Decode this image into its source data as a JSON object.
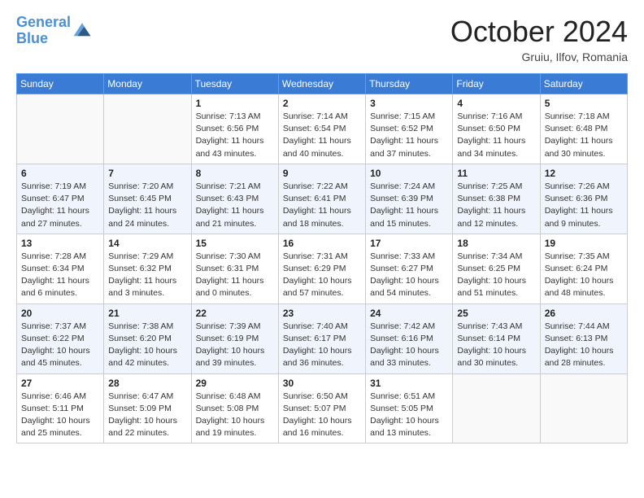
{
  "header": {
    "logo_line1": "General",
    "logo_line2": "Blue",
    "month": "October 2024",
    "location": "Gruiu, Ilfov, Romania"
  },
  "weekdays": [
    "Sunday",
    "Monday",
    "Tuesday",
    "Wednesday",
    "Thursday",
    "Friday",
    "Saturday"
  ],
  "weeks": [
    [
      {
        "day": "",
        "info": ""
      },
      {
        "day": "",
        "info": ""
      },
      {
        "day": "1",
        "info": "Sunrise: 7:13 AM\nSunset: 6:56 PM\nDaylight: 11 hours and 43 minutes."
      },
      {
        "day": "2",
        "info": "Sunrise: 7:14 AM\nSunset: 6:54 PM\nDaylight: 11 hours and 40 minutes."
      },
      {
        "day": "3",
        "info": "Sunrise: 7:15 AM\nSunset: 6:52 PM\nDaylight: 11 hours and 37 minutes."
      },
      {
        "day": "4",
        "info": "Sunrise: 7:16 AM\nSunset: 6:50 PM\nDaylight: 11 hours and 34 minutes."
      },
      {
        "day": "5",
        "info": "Sunrise: 7:18 AM\nSunset: 6:48 PM\nDaylight: 11 hours and 30 minutes."
      }
    ],
    [
      {
        "day": "6",
        "info": "Sunrise: 7:19 AM\nSunset: 6:47 PM\nDaylight: 11 hours and 27 minutes."
      },
      {
        "day": "7",
        "info": "Sunrise: 7:20 AM\nSunset: 6:45 PM\nDaylight: 11 hours and 24 minutes."
      },
      {
        "day": "8",
        "info": "Sunrise: 7:21 AM\nSunset: 6:43 PM\nDaylight: 11 hours and 21 minutes."
      },
      {
        "day": "9",
        "info": "Sunrise: 7:22 AM\nSunset: 6:41 PM\nDaylight: 11 hours and 18 minutes."
      },
      {
        "day": "10",
        "info": "Sunrise: 7:24 AM\nSunset: 6:39 PM\nDaylight: 11 hours and 15 minutes."
      },
      {
        "day": "11",
        "info": "Sunrise: 7:25 AM\nSunset: 6:38 PM\nDaylight: 11 hours and 12 minutes."
      },
      {
        "day": "12",
        "info": "Sunrise: 7:26 AM\nSunset: 6:36 PM\nDaylight: 11 hours and 9 minutes."
      }
    ],
    [
      {
        "day": "13",
        "info": "Sunrise: 7:28 AM\nSunset: 6:34 PM\nDaylight: 11 hours and 6 minutes."
      },
      {
        "day": "14",
        "info": "Sunrise: 7:29 AM\nSunset: 6:32 PM\nDaylight: 11 hours and 3 minutes."
      },
      {
        "day": "15",
        "info": "Sunrise: 7:30 AM\nSunset: 6:31 PM\nDaylight: 11 hours and 0 minutes."
      },
      {
        "day": "16",
        "info": "Sunrise: 7:31 AM\nSunset: 6:29 PM\nDaylight: 10 hours and 57 minutes."
      },
      {
        "day": "17",
        "info": "Sunrise: 7:33 AM\nSunset: 6:27 PM\nDaylight: 10 hours and 54 minutes."
      },
      {
        "day": "18",
        "info": "Sunrise: 7:34 AM\nSunset: 6:25 PM\nDaylight: 10 hours and 51 minutes."
      },
      {
        "day": "19",
        "info": "Sunrise: 7:35 AM\nSunset: 6:24 PM\nDaylight: 10 hours and 48 minutes."
      }
    ],
    [
      {
        "day": "20",
        "info": "Sunrise: 7:37 AM\nSunset: 6:22 PM\nDaylight: 10 hours and 45 minutes."
      },
      {
        "day": "21",
        "info": "Sunrise: 7:38 AM\nSunset: 6:20 PM\nDaylight: 10 hours and 42 minutes."
      },
      {
        "day": "22",
        "info": "Sunrise: 7:39 AM\nSunset: 6:19 PM\nDaylight: 10 hours and 39 minutes."
      },
      {
        "day": "23",
        "info": "Sunrise: 7:40 AM\nSunset: 6:17 PM\nDaylight: 10 hours and 36 minutes."
      },
      {
        "day": "24",
        "info": "Sunrise: 7:42 AM\nSunset: 6:16 PM\nDaylight: 10 hours and 33 minutes."
      },
      {
        "day": "25",
        "info": "Sunrise: 7:43 AM\nSunset: 6:14 PM\nDaylight: 10 hours and 30 minutes."
      },
      {
        "day": "26",
        "info": "Sunrise: 7:44 AM\nSunset: 6:13 PM\nDaylight: 10 hours and 28 minutes."
      }
    ],
    [
      {
        "day": "27",
        "info": "Sunrise: 6:46 AM\nSunset: 5:11 PM\nDaylight: 10 hours and 25 minutes."
      },
      {
        "day": "28",
        "info": "Sunrise: 6:47 AM\nSunset: 5:09 PM\nDaylight: 10 hours and 22 minutes."
      },
      {
        "day": "29",
        "info": "Sunrise: 6:48 AM\nSunset: 5:08 PM\nDaylight: 10 hours and 19 minutes."
      },
      {
        "day": "30",
        "info": "Sunrise: 6:50 AM\nSunset: 5:07 PM\nDaylight: 10 hours and 16 minutes."
      },
      {
        "day": "31",
        "info": "Sunrise: 6:51 AM\nSunset: 5:05 PM\nDaylight: 10 hours and 13 minutes."
      },
      {
        "day": "",
        "info": ""
      },
      {
        "day": "",
        "info": ""
      }
    ]
  ]
}
